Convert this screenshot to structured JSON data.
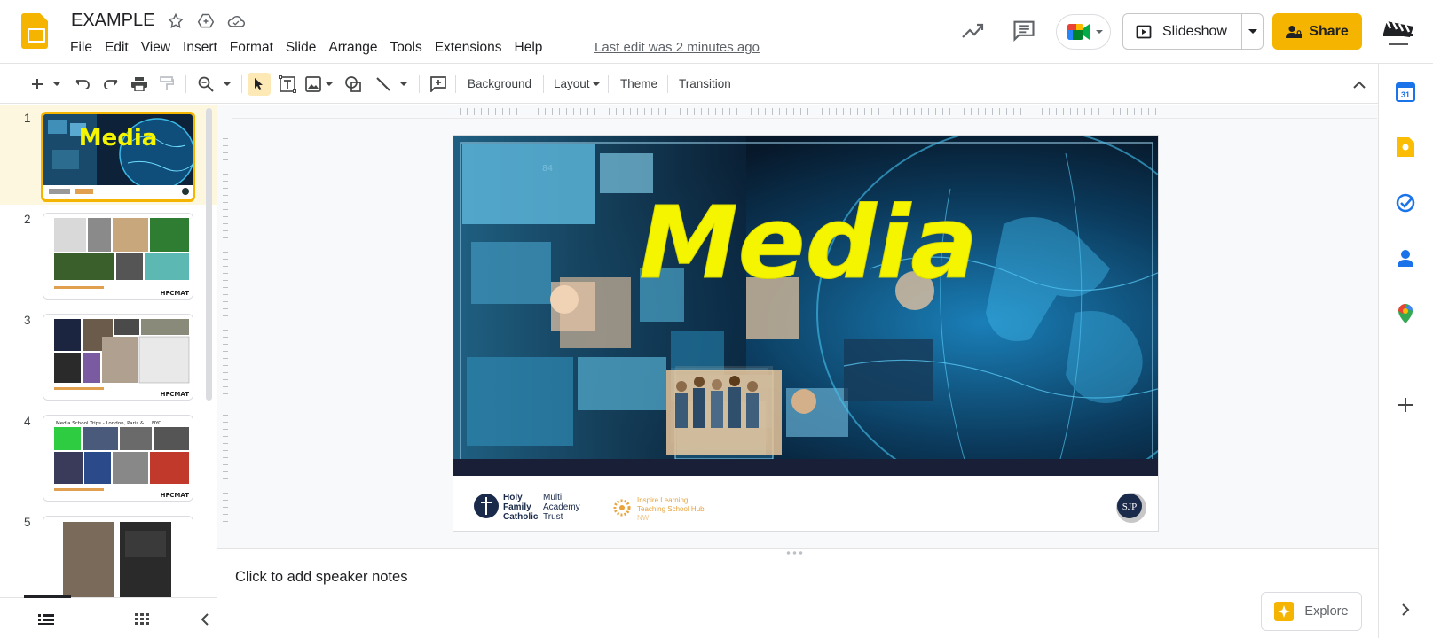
{
  "header": {
    "doc_title": "EXAMPLE",
    "menu": [
      "File",
      "Edit",
      "View",
      "Insert",
      "Format",
      "Slide",
      "Arrange",
      "Tools",
      "Extensions",
      "Help"
    ],
    "last_edit": "Last edit was 2 minutes ago",
    "slideshow_label": "Slideshow",
    "share_label": "Share"
  },
  "toolbar": {
    "background_label": "Background",
    "layout_label": "Layout",
    "theme_label": "Theme",
    "transition_label": "Transition"
  },
  "filmstrip": {
    "slides": [
      {
        "number": "1",
        "title": "Media",
        "selected": true
      },
      {
        "number": "2",
        "footer": "HFCMAT"
      },
      {
        "number": "3",
        "footer": "HFCMAT"
      },
      {
        "number": "4",
        "caption": "Media School Trips - London, Paris & ... NYC",
        "footer": "HFCMAT"
      },
      {
        "number": "5"
      }
    ]
  },
  "slide": {
    "title": "Media",
    "footer_org1": [
      "Holy",
      "Family",
      "Catholic"
    ],
    "footer_org2": [
      "Multi",
      "Academy",
      "Trust"
    ],
    "footer_hub": [
      "Inspire Learning",
      "Teaching School Hub",
      "NW"
    ],
    "footer_badge": "SJP"
  },
  "notes": {
    "placeholder": "Click to add speaker notes"
  },
  "explore": {
    "label": "Explore"
  },
  "colors": {
    "accent": "#f4b400",
    "slide_title": "#f5f500",
    "slide_bg": "#0e1b2e"
  }
}
